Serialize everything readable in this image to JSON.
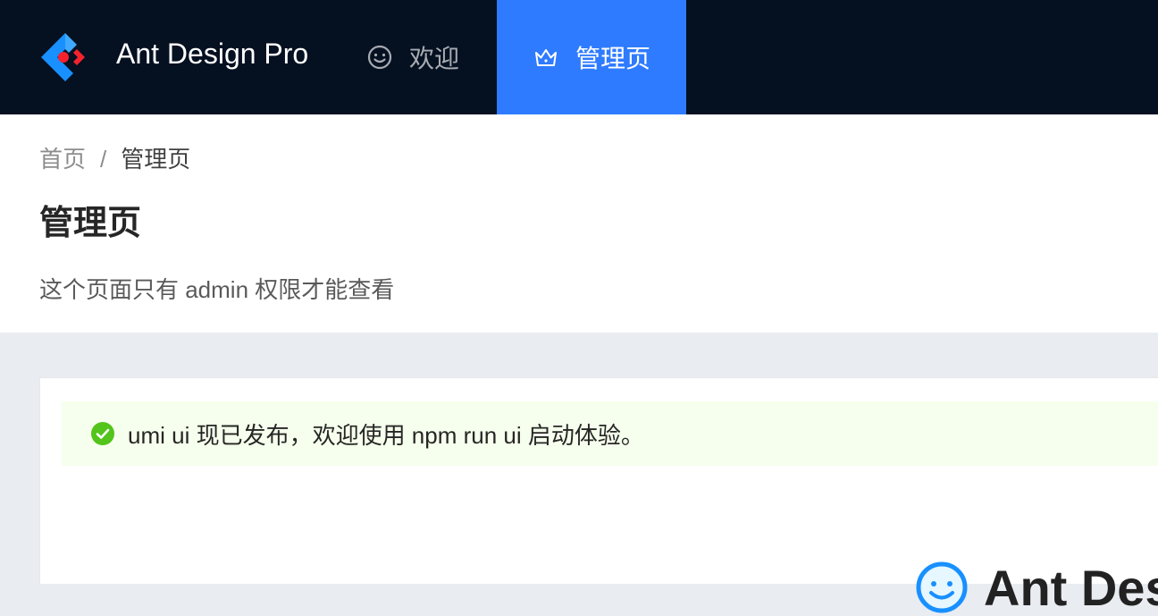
{
  "app": {
    "title": "Ant Design Pro"
  },
  "nav": {
    "items": [
      {
        "label": "欢迎",
        "icon": "smile-icon",
        "active": false
      },
      {
        "label": "管理页",
        "icon": "crown-icon",
        "active": true
      }
    ]
  },
  "breadcrumb": {
    "home": "首页",
    "separator": "/",
    "current": "管理页"
  },
  "page": {
    "title": "管理页",
    "description": "这个页面只有 admin 权限才能查看"
  },
  "alert": {
    "type": "success",
    "icon": "check-circle-icon",
    "message": "umi ui 现已发布，欢迎使用 npm run ui 启动体验。"
  },
  "footer_brand": {
    "text": "Ant Des",
    "icon": "smile-face-icon"
  },
  "colors": {
    "header_bg": "#051021",
    "accent": "#2f7bff",
    "success": "#52c41a",
    "alert_bg": "#f6ffed",
    "page_bg": "#e9ecf0"
  }
}
